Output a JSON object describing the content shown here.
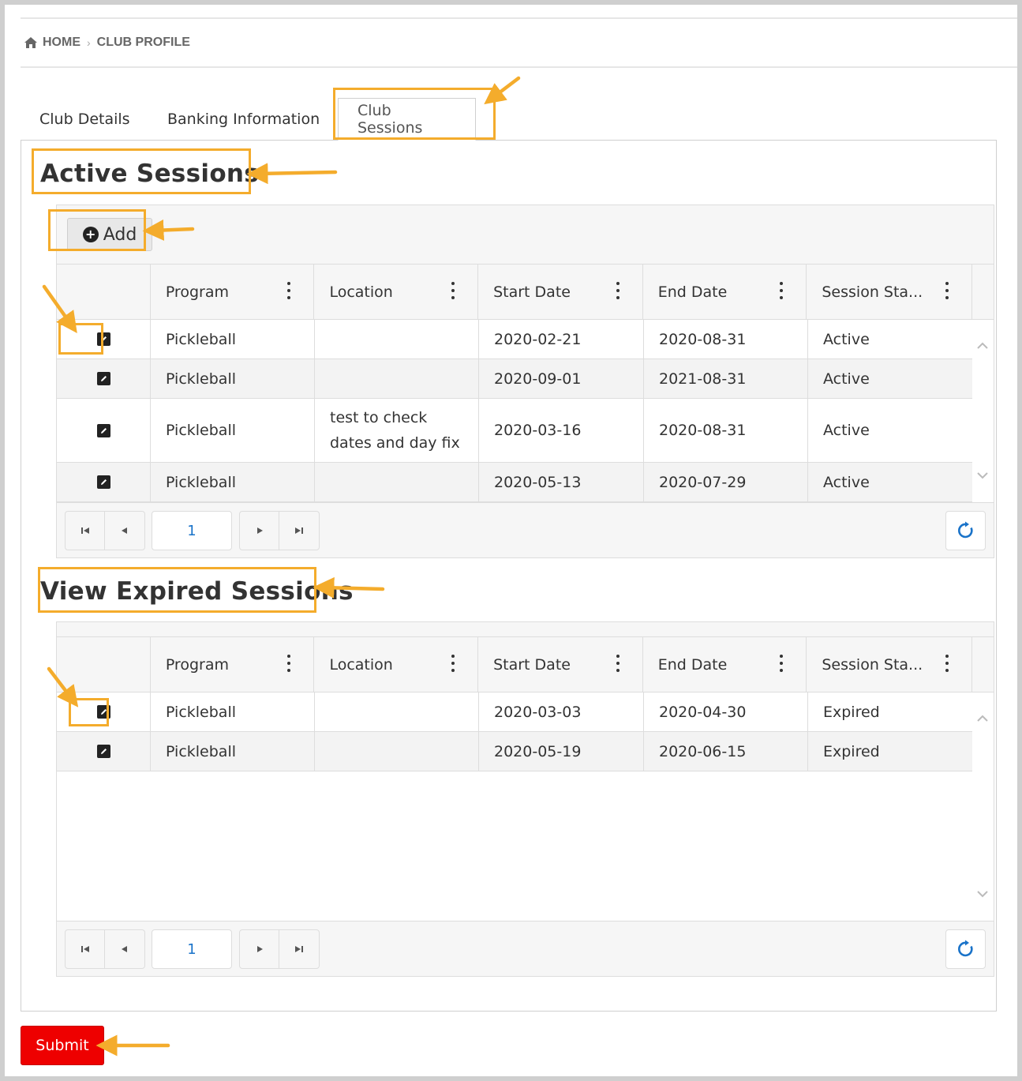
{
  "breadcrumb": {
    "home": "HOME",
    "current": "CLUB PROFILE"
  },
  "tabs": [
    {
      "label": "Club Details",
      "active": false
    },
    {
      "label": "Banking Information",
      "active": false
    },
    {
      "label": "Club Sessions",
      "active": true
    }
  ],
  "active_sessions": {
    "title": "Active Sessions",
    "add_label": "Add",
    "columns": [
      "Program",
      "Location",
      "Start Date",
      "End Date",
      "Session Sta..."
    ],
    "rows": [
      {
        "program": "Pickleball",
        "location": "",
        "start": "2020-02-21",
        "end": "2020-08-31",
        "status": "Active"
      },
      {
        "program": "Pickleball",
        "location": "",
        "start": "2020-09-01",
        "end": "2021-08-31",
        "status": "Active"
      },
      {
        "program": "Pickleball",
        "location": "test to check dates and day fix",
        "start": "2020-03-16",
        "end": "2020-08-31",
        "status": "Active"
      },
      {
        "program": "Pickleball",
        "location": "",
        "start": "2020-05-13",
        "end": "2020-07-29",
        "status": "Active"
      }
    ],
    "page": "1"
  },
  "expired_sessions": {
    "title": "View Expired Sessions",
    "columns": [
      "Program",
      "Location",
      "Start Date",
      "End Date",
      "Session Sta..."
    ],
    "rows": [
      {
        "program": "Pickleball",
        "location": "",
        "start": "2020-03-03",
        "end": "2020-04-30",
        "status": "Expired"
      },
      {
        "program": "Pickleball",
        "location": "",
        "start": "2020-05-19",
        "end": "2020-06-15",
        "status": "Expired"
      }
    ],
    "page": "1"
  },
  "submit_label": "Submit",
  "colors": {
    "accent": "#f4ac2c",
    "submit": "#ee0000",
    "link": "#1a73c9"
  },
  "icons": [
    "home-icon",
    "chevron-right-icon",
    "plus-circle-icon",
    "kebab-icon",
    "edit-icon",
    "first-page-icon",
    "prev-page-icon",
    "next-page-icon",
    "last-page-icon",
    "refresh-icon",
    "scroll-up-icon",
    "scroll-down-icon"
  ]
}
